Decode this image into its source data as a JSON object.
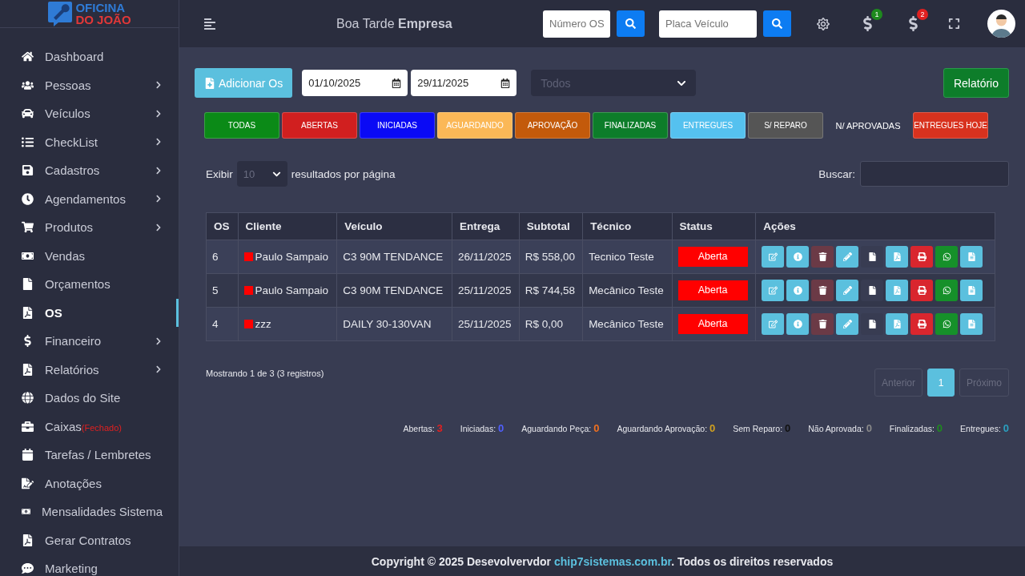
{
  "logo": {
    "line1": "OFICINA",
    "line2": "DO JOÃO"
  },
  "sidebar": {
    "items": [
      {
        "label": "Dashboard",
        "submenu": false,
        "selected": false
      },
      {
        "label": "Pessoas",
        "submenu": true,
        "selected": false
      },
      {
        "label": "Veículos",
        "submenu": true,
        "selected": false
      },
      {
        "label": "CheckList",
        "submenu": true,
        "selected": false
      },
      {
        "label": "Cadastros",
        "submenu": true,
        "selected": false
      },
      {
        "label": "Agendamentos",
        "submenu": true,
        "selected": false
      },
      {
        "label": "Produtos",
        "submenu": true,
        "selected": false
      },
      {
        "label": "Vendas",
        "submenu": false,
        "selected": false
      },
      {
        "label": "Orçamentos",
        "submenu": false,
        "selected": false
      },
      {
        "label": "OS",
        "submenu": false,
        "selected": true
      },
      {
        "label": "Financeiro",
        "submenu": true,
        "selected": false
      },
      {
        "label": "Relatórios",
        "submenu": true,
        "selected": false
      },
      {
        "label": "Dados do Site",
        "submenu": false,
        "selected": false
      },
      {
        "label": "Caixas",
        "note": "(Fechado)",
        "submenu": false,
        "selected": false
      },
      {
        "label": "Tarefas / Lembretes",
        "submenu": false,
        "selected": false
      },
      {
        "label": "Anotações",
        "submenu": false,
        "selected": false
      },
      {
        "label": "Mensalidades Sistema",
        "submenu": false,
        "selected": false
      },
      {
        "label": "Gerar Contratos",
        "submenu": false,
        "selected": false
      },
      {
        "label": "Marketing",
        "submenu": false,
        "selected": false
      }
    ]
  },
  "header": {
    "greeting": "Boa Tarde **Empresa**",
    "os_search": {
      "placeholder": "Número OS"
    },
    "plate_search": {
      "placeholder": "Placa Veículo"
    },
    "badges": [
      {
        "count": "1",
        "color": "#1e8a1e"
      },
      {
        "count": "2",
        "color": "#e02020"
      }
    ]
  },
  "toolbar": {
    "add_button": "Adicionar Os",
    "date_from": "01/10/2025",
    "date_to": "29/11/2025",
    "status_select": {
      "placeholder": "Todos"
    },
    "report_button": "Relatório"
  },
  "filters": [
    {
      "label": "TODAS",
      "kind": "filled",
      "color": "#0b8a17"
    },
    {
      "label": "ABERTAS",
      "kind": "filled",
      "color": "#d11f1f"
    },
    {
      "label": "INICIADAS",
      "kind": "filled",
      "color": "#0a0af5"
    },
    {
      "label": "AGUARDANDO",
      "kind": "filled",
      "color": "#fbb857"
    },
    {
      "label": "APROVAÇÃO",
      "kind": "filled",
      "color": "#c35a0b"
    },
    {
      "label": "FINALIZADAS",
      "kind": "filled",
      "color": "#0d7d2a"
    },
    {
      "label": "ENTREGUES",
      "kind": "filled",
      "color": "#55c1ef"
    },
    {
      "label": "S/ REPARO",
      "kind": "filled",
      "color": "#555555"
    },
    {
      "label": "N/ APROVADAS",
      "kind": "plain",
      "color": "#383c52"
    },
    {
      "label": "ENTREGUES HOJE",
      "kind": "filled",
      "color": "#d8321e"
    }
  ],
  "table": {
    "length_label": "Exibir",
    "length_value": "10",
    "length_suffix": "resultados por página",
    "search_label": "Buscar:",
    "columns": [
      "OS",
      "Cliente",
      "Veículo",
      "Entrega",
      "Subtotal",
      "Técnico",
      "Status",
      "Ações"
    ],
    "rows": [
      {
        "os": "6",
        "client": "Paulo Sampaio",
        "color": "#ff0000",
        "vehicle": "C3 90M TENDANCE",
        "date": "26/11/2025",
        "subtotal": "R$ 558,00",
        "tech": "Tecnico Teste",
        "status": "Aberta"
      },
      {
        "os": "5",
        "client": "Paulo Sampaio",
        "color": "#ff0000",
        "vehicle": "C3 90M TENDANCE",
        "date": "25/11/2025",
        "subtotal": "R$ 744,58",
        "tech": "Mecânico Teste",
        "status": "Aberta"
      },
      {
        "os": "4",
        "client": "zzz",
        "color": "#ff0000",
        "vehicle": "DAILY 30-130VAN",
        "date": "25/11/2025",
        "subtotal": "R$ 0,00",
        "tech": "Mecânico Teste",
        "status": "Aberta"
      }
    ],
    "info": "Mostrando 1 de 3 (3 registros)",
    "pagination": [
      {
        "label": "Anterior",
        "selected": false,
        "disabled": true
      },
      {
        "label": "1",
        "selected": true,
        "disabled": false
      },
      {
        "label": "Próximo",
        "selected": false,
        "disabled": true
      }
    ]
  },
  "row_actions": [
    {
      "kind": "edit",
      "color": "#5bc0de"
    },
    {
      "kind": "info",
      "color": "#5bc0de"
    },
    {
      "kind": "delete",
      "color": "#6b3a46"
    },
    {
      "kind": "pencil",
      "color": "#5bc0de"
    },
    {
      "kind": "file",
      "color": "#383c52"
    },
    {
      "kind": "pdf",
      "color": "#5bc0de"
    },
    {
      "kind": "print",
      "color": "#d9262e"
    },
    {
      "kind": "whatsapp",
      "color": "#16902a"
    },
    {
      "kind": "doc",
      "color": "#5bc0de"
    }
  ],
  "summary": [
    {
      "label": "Abertas:",
      "value": "3",
      "color": "#e02020"
    },
    {
      "label": "Iniciadas:",
      "value": "0",
      "color": "#5060ff"
    },
    {
      "label": "Aguardando Peça:",
      "value": "0",
      "color": "#f07020"
    },
    {
      "label": "Aguardando Aprovação:",
      "value": "0",
      "color": "#d0a020"
    },
    {
      "label": "Sem Reparo:",
      "value": "0",
      "color": "#111111"
    },
    {
      "label": "Não Aprovada:",
      "value": "0",
      "color": "#8a8a8a"
    },
    {
      "label": "Finalizadas:",
      "value": "0",
      "color": "#1e8a1e"
    },
    {
      "label": "Entregues:",
      "value": "0",
      "color": "#2aa0c0"
    }
  ],
  "footer": {
    "prefix": "Copyright © 2025 Desevolvervdor ",
    "link": "chip7sistemas.com.br",
    "suffix": ". Todos os direitos reservados"
  }
}
